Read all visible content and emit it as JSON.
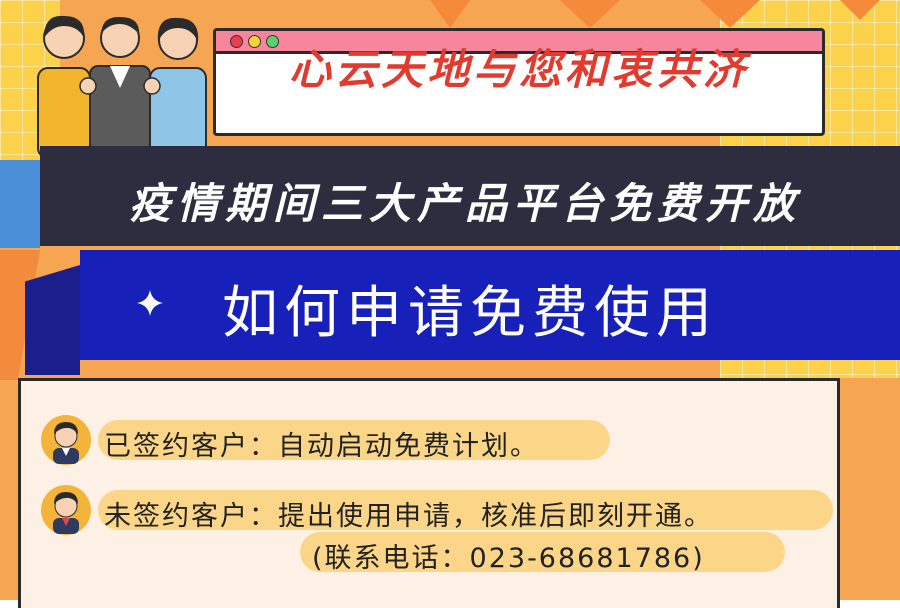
{
  "title_window": {
    "title": "心云天地与您和衷共济"
  },
  "dark_banner": {
    "text": "疫情期间三大产品平台免费开放"
  },
  "blue_banner": {
    "text": "如何申请免费使用"
  },
  "rows": [
    {
      "text": "已签约客户：自动启动免费计划。"
    },
    {
      "text": "未签约客户：提出使用申请，核准后即刻开通。"
    },
    {
      "text": "(联系电话：023-68681786)"
    }
  ],
  "colors": {
    "title_red": "#e23a2e",
    "dark_banner": "#2e2d40",
    "blue_banner": "#1720b8",
    "highlight": "#fbd689"
  }
}
